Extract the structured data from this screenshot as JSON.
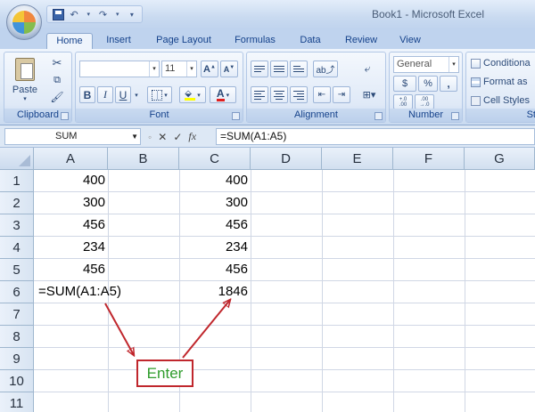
{
  "window": {
    "title": "Book1 - Microsoft Excel"
  },
  "tabs": [
    "Home",
    "Insert",
    "Page Layout",
    "Formulas",
    "Data",
    "Review",
    "View"
  ],
  "ribbon": {
    "clipboard": {
      "label": "Clipboard",
      "paste_label": "Paste"
    },
    "font": {
      "label": "Font",
      "font_name": "",
      "font_size": "11",
      "bold": "B",
      "italic": "I",
      "underline": "U"
    },
    "alignment": {
      "label": "Alignment"
    },
    "number": {
      "label": "Number",
      "format": "General",
      "currency": "$",
      "percent": "%",
      "comma": ",",
      "inc_decimal": "+.0\n.00",
      "dec_decimal": ".00\n→.0"
    },
    "styles": {
      "label": "St",
      "conditional": "Conditiona",
      "format_as": "Format as",
      "cell_styles": "Cell Styles"
    }
  },
  "formula_bar": {
    "name_box": "SUM",
    "fx": "fx",
    "formula": "=SUM(A1:A5)"
  },
  "sheet": {
    "columns": [
      "A",
      "B",
      "C",
      "D",
      "E",
      "F",
      "G"
    ],
    "rows": [
      "1",
      "2",
      "3",
      "4",
      "5",
      "6",
      "7",
      "8",
      "9",
      "10",
      "11"
    ],
    "col_a": [
      "400",
      "300",
      "456",
      "234",
      "456"
    ],
    "col_c": [
      "400",
      "300",
      "456",
      "234",
      "456"
    ],
    "a6_edit": "=SUM(A1:A5)",
    "c6_result": "1846"
  },
  "annotation": {
    "enter_label": "Enter",
    "color": "#c0272d",
    "text_color": "#2f9c2c"
  }
}
